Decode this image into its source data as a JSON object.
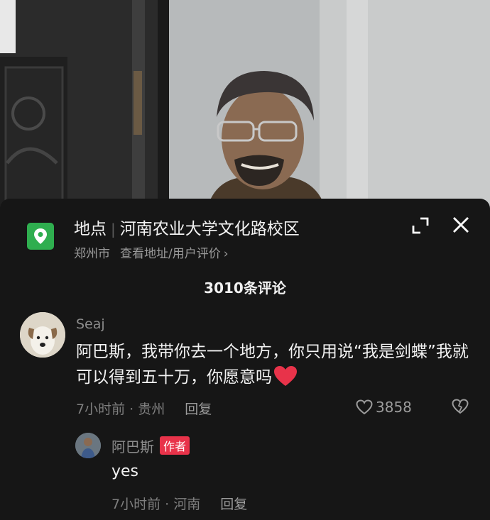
{
  "location": {
    "label": "地点",
    "name": "河南农业大学文化路校区",
    "city": "郑州市",
    "link": "查看地址/用户评价",
    "chevron": "›"
  },
  "header_icons": {
    "expand": "expand-icon",
    "close": "close-icon"
  },
  "comment_count": "3010条评论",
  "comments": [
    {
      "username": "Seaj",
      "text": "阿巴斯，我带你去一个地方，你只用说“我是剑蝶”我就可以得到五十万，你愿意吗",
      "emoji": "red-heart",
      "time_location": "7小时前 · 贵州",
      "reply_label": "回复",
      "likes": "3858"
    }
  ],
  "replies": [
    {
      "username": "阿巴斯",
      "badge": "作者",
      "text": "yes",
      "time_location": "7小时前 · 河南",
      "reply_label": "回复"
    }
  ],
  "colors": {
    "location_green": "#2fae4f",
    "author_badge": "#e8334a",
    "heart": "#e8334a",
    "background": "#161616"
  }
}
